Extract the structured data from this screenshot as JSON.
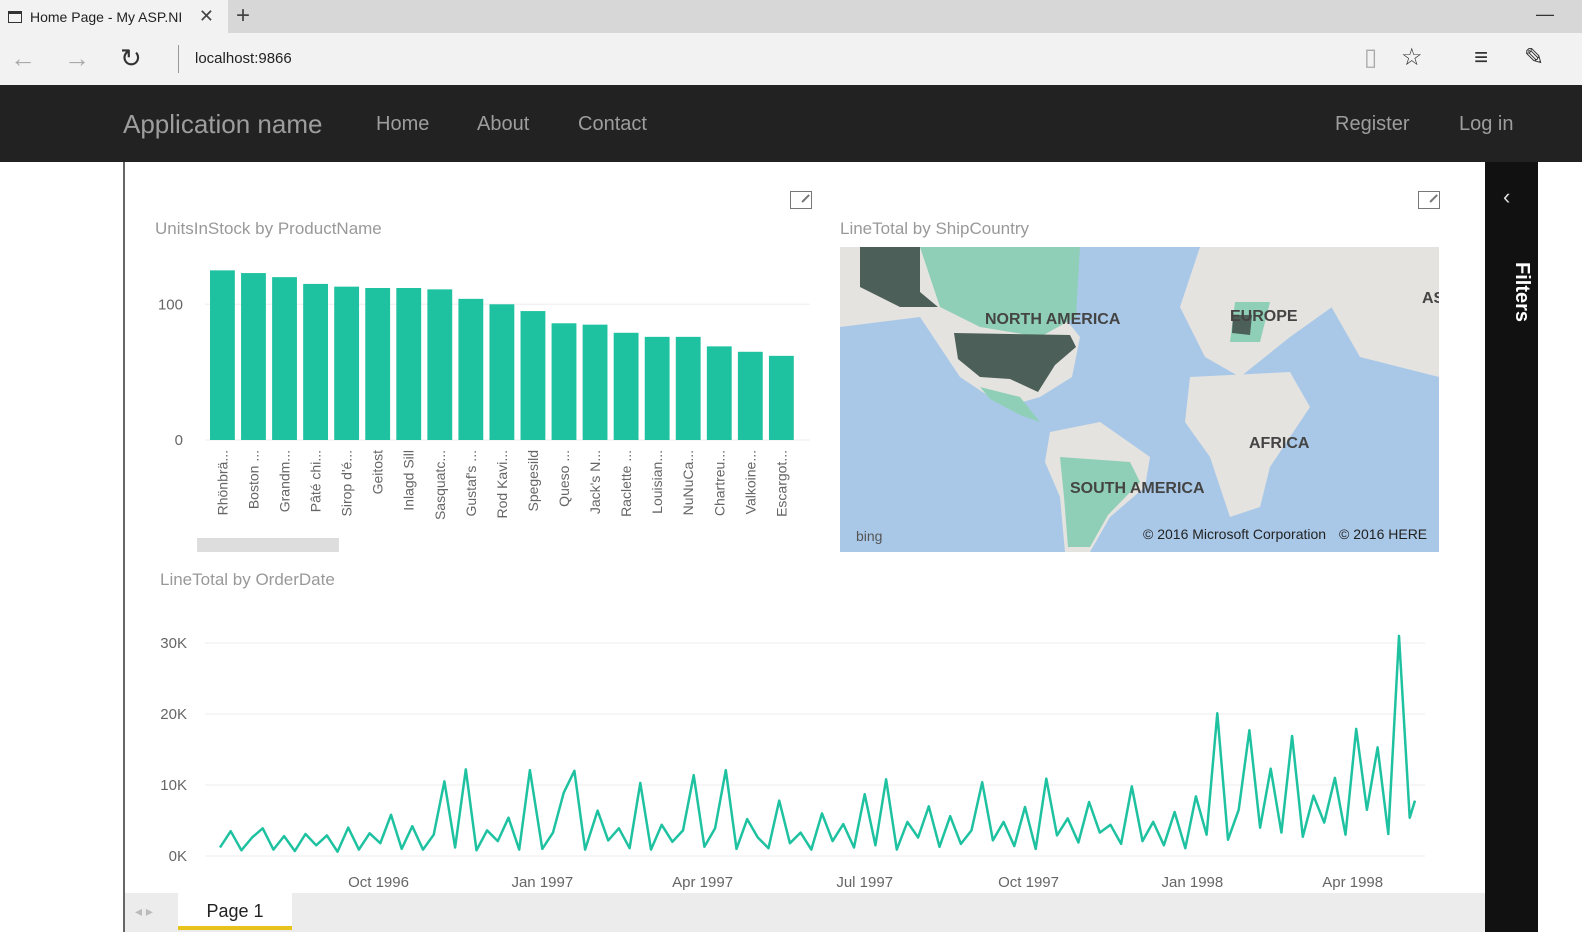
{
  "browser": {
    "tab_title": "Home Page - My ASP.NI",
    "close_glyph": "✕",
    "newtab_glyph": "+",
    "minimize_glyph": "—",
    "url": "localhost:9866",
    "back_glyph": "←",
    "forward_glyph": "→",
    "refresh_glyph": "↻",
    "reading_glyph": "▯",
    "favorite_glyph": "☆",
    "hub_glyph": "≡",
    "note_glyph": "✎"
  },
  "app": {
    "brand": "Application name",
    "nav": [
      "Home",
      "About",
      "Contact"
    ],
    "register": "Register",
    "login": "Log in"
  },
  "report": {
    "filters_label": "Filters",
    "filters_chevron": "‹",
    "page_arrows": "◂ ▸",
    "page_tab": "Page 1",
    "map": {
      "title": "LineTotal by ShipCountry",
      "labels": [
        "NORTH AMERICA",
        "EUROPE",
        "AFRICA",
        "SOUTH AMERICA",
        "AS"
      ],
      "bing": "bing",
      "copyright1": "© 2016 Microsoft Corporation",
      "copyright2": "© 2016 HERE"
    }
  },
  "colors": {
    "accent": "#1fc2a0",
    "nav_bg": "#222222",
    "pane_bg": "#111111"
  },
  "chart_data": [
    {
      "type": "bar",
      "title": "UnitsInStock by ProductName",
      "categories": [
        "Rhönbrä...",
        "Boston ...",
        "Grandm...",
        "Pâté chi...",
        "Sirop d'é...",
        "Geitost",
        "Inlagd Sill",
        "Sasquatc...",
        "Gustaf's ...",
        "Rod Kavi...",
        "Spegesild",
        "Queso ...",
        "Jack's N...",
        "Raclette ...",
        "Louisian...",
        "NuNuCa...",
        "Chartreu...",
        "Valkoine...",
        "Escargot..."
      ],
      "values": [
        125,
        123,
        120,
        115,
        113,
        112,
        112,
        111,
        104,
        100,
        95,
        86,
        85,
        79,
        76,
        76,
        69,
        65,
        62
      ],
      "ylim": [
        0,
        140
      ],
      "yticks": [
        0,
        100
      ],
      "grid": true
    },
    {
      "type": "line",
      "title": "LineTotal by OrderDate",
      "xticks": [
        "Oct 1996",
        "Jan 1997",
        "Apr 1997",
        "Jul 1997",
        "Oct 1997",
        "Jan 1998",
        "Apr 1998"
      ],
      "yticks": [
        "0K",
        "10K",
        "20K",
        "30K"
      ],
      "ylim": [
        0,
        32000
      ],
      "x_range": [
        "1996-07-04",
        "1998-05-06"
      ],
      "series": [
        {
          "x": [
            "1996-07-04",
            "1996-07-10",
            "1996-07-16",
            "1996-07-22",
            "1996-07-28",
            "1996-08-03",
            "1996-08-09",
            "1996-08-15",
            "1996-08-21",
            "1996-08-27",
            "1996-09-02",
            "1996-09-08",
            "1996-09-14",
            "1996-09-20",
            "1996-09-26",
            "1996-10-02",
            "1996-10-08",
            "1996-10-14",
            "1996-10-20",
            "1996-10-26",
            "1996-11-01",
            "1996-11-07",
            "1996-11-13",
            "1996-11-19",
            "1996-11-25",
            "1996-12-01",
            "1996-12-07",
            "1996-12-13",
            "1996-12-19",
            "1996-12-25",
            "1997-01-01",
            "1997-01-07",
            "1997-01-13",
            "1997-01-19",
            "1997-01-25",
            "1997-02-01",
            "1997-02-07",
            "1997-02-13",
            "1997-02-19",
            "1997-02-25",
            "1997-03-03",
            "1997-03-09",
            "1997-03-15",
            "1997-03-21",
            "1997-03-27",
            "1997-04-02",
            "1997-04-08",
            "1997-04-14",
            "1997-04-20",
            "1997-04-26",
            "1997-05-02",
            "1997-05-08",
            "1997-05-14",
            "1997-05-20",
            "1997-05-26",
            "1997-06-01",
            "1997-06-07",
            "1997-06-13",
            "1997-06-19",
            "1997-06-25",
            "1997-07-01",
            "1997-07-07",
            "1997-07-13",
            "1997-07-19",
            "1997-07-25",
            "1997-07-31",
            "1997-08-06",
            "1997-08-12",
            "1997-08-18",
            "1997-08-24",
            "1997-08-30",
            "1997-09-05",
            "1997-09-11",
            "1997-09-17",
            "1997-09-23",
            "1997-09-29",
            "1997-10-05",
            "1997-10-11",
            "1997-10-17",
            "1997-10-23",
            "1997-10-29",
            "1997-11-04",
            "1997-11-10",
            "1997-11-16",
            "1997-11-22",
            "1997-11-28",
            "1997-12-04",
            "1997-12-10",
            "1997-12-16",
            "1997-12-22",
            "1997-12-28",
            "1998-01-03",
            "1998-01-09",
            "1998-01-15",
            "1998-01-21",
            "1998-01-27",
            "1998-02-02",
            "1998-02-08",
            "1998-02-14",
            "1998-02-20",
            "1998-02-26",
            "1998-03-04",
            "1998-03-10",
            "1998-03-16",
            "1998-03-22",
            "1998-03-28",
            "1998-04-03",
            "1998-04-09",
            "1998-04-15",
            "1998-04-21",
            "1998-04-27",
            "1998-05-03",
            "1998-05-06"
          ],
          "values": [
            1200,
            3500,
            800,
            2600,
            3900,
            900,
            2800,
            700,
            3100,
            1500,
            2900,
            600,
            4000,
            900,
            3200,
            1800,
            5800,
            1000,
            4200,
            900,
            3000,
            10500,
            1200,
            12200,
            800,
            3600,
            2100,
            5400,
            900,
            12100,
            1000,
            3300,
            8900,
            12000,
            900,
            6400,
            2200,
            3900,
            1100,
            10300,
            900,
            4400,
            2000,
            3600,
            11400,
            1300,
            3900,
            12100,
            1000,
            5200,
            2600,
            1100,
            7800,
            1800,
            3300,
            900,
            6000,
            2100,
            4500,
            1200,
            8700,
            1500,
            10800,
            900,
            4800,
            2600,
            7000,
            1300,
            5600,
            1700,
            3600,
            10400,
            2200,
            4800,
            1400,
            6900,
            1000,
            10900,
            2900,
            5300,
            1900,
            7600,
            3300,
            4400,
            1700,
            9800,
            2100,
            4800,
            1500,
            6200,
            1100,
            8400,
            3000,
            20100,
            2300,
            6500,
            17700,
            4000,
            12300,
            3300,
            16900,
            2700,
            8500,
            4700,
            11000,
            3000,
            17900,
            6500,
            15300,
            3100,
            31000,
            5400,
            7800
          ]
        }
      ]
    }
  ]
}
